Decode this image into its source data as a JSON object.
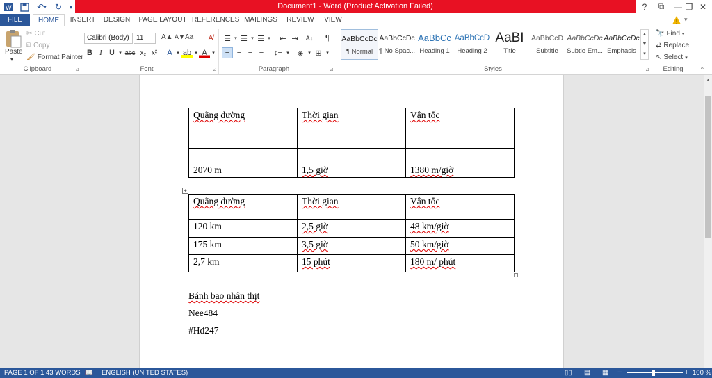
{
  "titlebar": {
    "title": "Document1 - Word (Product Activation Failed)",
    "help": "?",
    "ribbon_display": "⧉",
    "minimize": "—",
    "restore": "❐",
    "close": "✕"
  },
  "tabs": [
    "FILE",
    "HOME",
    "INSERT",
    "DESIGN",
    "PAGE LAYOUT",
    "REFERENCES",
    "MAILINGS",
    "REVIEW",
    "VIEW"
  ],
  "clipboard": {
    "paste": "Paste",
    "cut": "Cut",
    "copy": "Copy",
    "format_painter": "Format Painter",
    "label": "Clipboard"
  },
  "font": {
    "name": "Calibri (Body)",
    "size": "11",
    "grow": "A▲",
    "shrink": "A▼",
    "case": "Aa",
    "label": "Font"
  },
  "paragraph": {
    "label": "Paragraph"
  },
  "styles": {
    "label": "Styles",
    "items": [
      {
        "preview": "AaBbCcDc",
        "name": "¶ Normal"
      },
      {
        "preview": "AaBbCcDc",
        "name": "¶ No Spac..."
      },
      {
        "preview": "AaBbCc",
        "name": "Heading 1"
      },
      {
        "preview": "AaBbCcD",
        "name": "Heading 2"
      },
      {
        "preview": "AaBI",
        "name": "Title"
      },
      {
        "preview": "AaBbCcD",
        "name": "Subtitle"
      },
      {
        "preview": "AaBbCcDc",
        "name": "Subtle Em..."
      },
      {
        "preview": "AaBbCcDc",
        "name": "Emphasis"
      }
    ]
  },
  "editing": {
    "find": "Find",
    "replace": "Replace",
    "select": "Select",
    "label": "Editing"
  },
  "table1": [
    [
      "Quãng đường",
      "Thời gian",
      "Vận tốc"
    ],
    [
      "",
      "",
      ""
    ],
    [
      "",
      "",
      ""
    ],
    [
      "2070 m",
      "1,5 giờ",
      "1380 m/giờ"
    ]
  ],
  "table2": [
    [
      "Quãng đường",
      "Thời gian",
      "Vận tốc"
    ],
    [
      "120 km",
      "2,5 giờ",
      "48 km/giờ"
    ],
    [
      "175 km",
      "3,5 giờ",
      "50 km/giờ"
    ],
    [
      "2,7 km",
      "15 phút",
      "180 m/ phút"
    ]
  ],
  "paragraphs": [
    "Bánh bao nhân thịt",
    "Nee484",
    "#Hđ247"
  ],
  "status": {
    "page": "PAGE 1 OF 1",
    "words": "43 WORDS",
    "language": "ENGLISH (UNITED STATES)",
    "zoom": "100 %"
  },
  "colors": {
    "accent": "#2b579a",
    "titlebar_alert": "#e81123"
  }
}
